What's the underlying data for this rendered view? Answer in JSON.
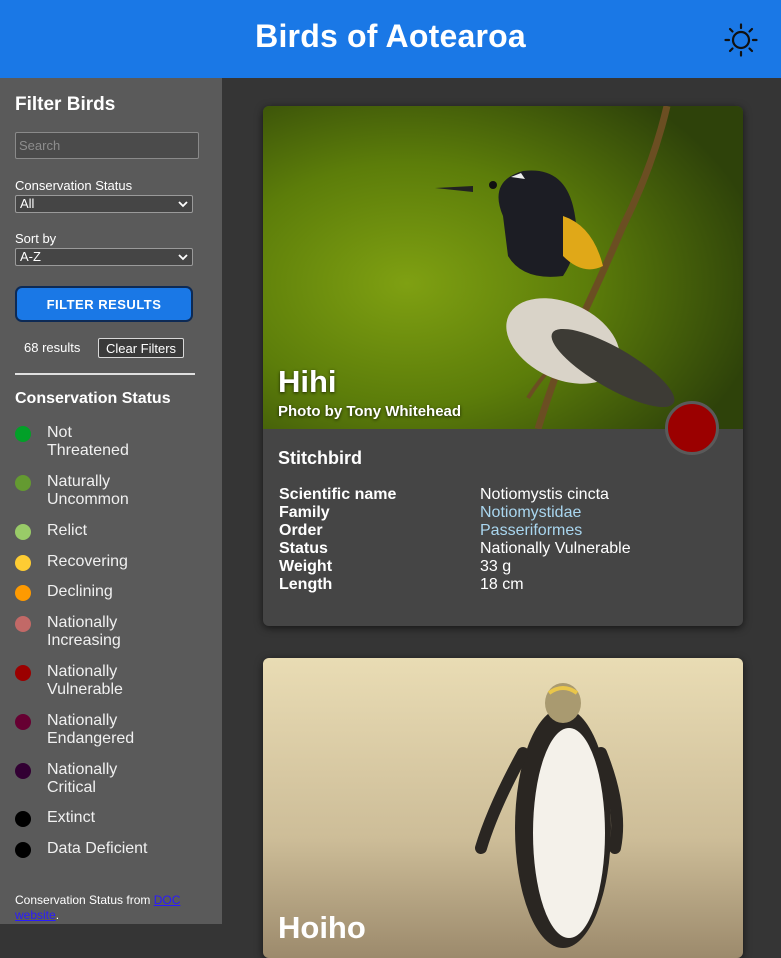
{
  "header": {
    "title": "Birds of Aotearoa",
    "theme_icon": "sun-icon"
  },
  "sidebar": {
    "heading": "Filter Birds",
    "search_placeholder": "Search",
    "search_value": "",
    "conservation_label": "Conservation Status",
    "conservation_selected": "All",
    "sort_label": "Sort by",
    "sort_selected": "A-Z",
    "filter_button": "FILTER RESULTS",
    "results_count": "68 results",
    "clear_button": "Clear Filters",
    "legend_title": "Conservation Status",
    "legend": [
      {
        "label": "Not Threatened",
        "color": "#02a028"
      },
      {
        "label": "Naturally Uncommon",
        "color": "#649a31"
      },
      {
        "label": "Relict",
        "color": "#99cb68"
      },
      {
        "label": "Recovering",
        "color": "#fecc33"
      },
      {
        "label": "Declining",
        "color": "#fe9a01"
      },
      {
        "label": "Nationally Increasing",
        "color": "#c26967"
      },
      {
        "label": "Nationally Vulnerable",
        "color": "#9b0000"
      },
      {
        "label": "Nationally Endangered",
        "color": "#660032"
      },
      {
        "label": "Nationally Critical",
        "color": "#320033"
      },
      {
        "label": "Extinct",
        "color": "#000000"
      },
      {
        "label": "Data Deficient",
        "color": "#000000"
      }
    ],
    "footer_prefix": "Conservation Status from ",
    "footer_link": "DOC website",
    "footer_suffix": "."
  },
  "cards": [
    {
      "primary_name": "Hihi",
      "photo_credit": "Photo by Tony Whitehead",
      "english_name": "Stitchbird",
      "status_color": "#9b0000",
      "facts": [
        {
          "label": "Scientific name",
          "value": "Notiomystis cincta",
          "link": false
        },
        {
          "label": "Family",
          "value": "Notiomystidae",
          "link": true
        },
        {
          "label": "Order",
          "value": "Passeriformes",
          "link": true
        },
        {
          "label": "Status",
          "value": "Nationally Vulnerable",
          "link": false
        },
        {
          "label": "Weight",
          "value": "33 g",
          "link": false
        },
        {
          "label": "Length",
          "value": "18 cm",
          "link": false
        }
      ]
    },
    {
      "primary_name": "Hoiho"
    }
  ]
}
